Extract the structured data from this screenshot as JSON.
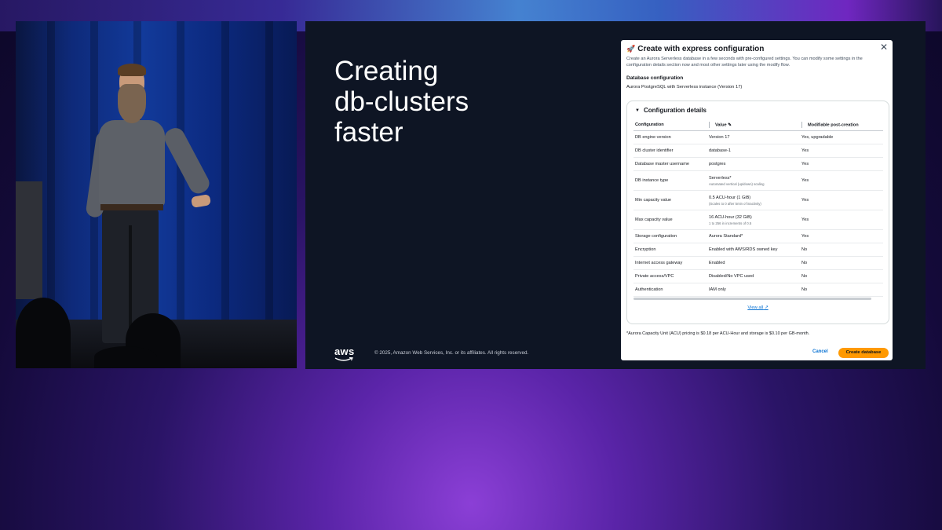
{
  "slide": {
    "title": "Creating\ndb-clusters\nfaster",
    "logo_text": "aws",
    "copyright": "© 2025, Amazon Web Services, Inc. or its affiliates. All rights reserved."
  },
  "modal": {
    "title": "Create with express configuration",
    "description": "Create an Aurora Serverless database in a few seconds with pre-configured settings. You can modify some settings in the configuration details section now and most other settings later using the modify flow.",
    "db_config_heading": "Database configuration",
    "db_config_value": "Aurora PostgreSQL with Serverless instance (Version 17)",
    "config_details_heading": "Configuration details",
    "table": {
      "headers": [
        "Configuration",
        "Value",
        "Modifiable post-creation"
      ],
      "rows": [
        {
          "config": "DB engine version",
          "value": "Version 17",
          "sub": "",
          "modifiable": "Yes, upgradable"
        },
        {
          "config": "DB cluster identifier",
          "value": "database-1",
          "sub": "",
          "modifiable": "Yes"
        },
        {
          "config": "Database master username",
          "value": "postgres",
          "sub": "",
          "modifiable": "Yes"
        },
        {
          "config": "DB instance type",
          "value": "Serverless*",
          "sub": "Automated vertical (up/down) scaling",
          "modifiable": "Yes"
        },
        {
          "config": "Min capacity value",
          "value": "0.5 ACU-hour (1 GiB)",
          "sub": "(Scales to 0 after 5min of inactivity)",
          "modifiable": "Yes"
        },
        {
          "config": "Max capacity value",
          "value": "16 ACU-hour (32 GiB)",
          "sub": "1 to 256 in increments of 0.5",
          "modifiable": "Yes"
        },
        {
          "config": "Storage configuration",
          "value": "Aurora Standard*",
          "sub": "",
          "modifiable": "Yes"
        },
        {
          "config": "Encryption",
          "value": "Enabled with AWS/RDS owned key",
          "sub": "",
          "modifiable": "No"
        },
        {
          "config": "Internet access gateway",
          "value": "Enabled",
          "sub": "",
          "modifiable": "No"
        },
        {
          "config": "Private access/VPC",
          "value": "Disabled/No VPC used",
          "sub": "",
          "modifiable": "No"
        },
        {
          "config": "Authentication",
          "value": "IAM only",
          "sub": "",
          "modifiable": "No"
        }
      ]
    },
    "view_all": "View all",
    "footnote": "*Aurora Capacity Unit (ACU) pricing is $0.18 per ACU-Hour and storage is $0.10 per GB-month.",
    "cancel_label": "Cancel",
    "create_label": "Create database",
    "icons": {
      "title": "rocket-icon",
      "close": "close-icon",
      "view_all": "external-link-icon",
      "value_header": "edit-icon"
    },
    "colors": {
      "primary_button": "#ff9900",
      "link": "#0972d3"
    }
  }
}
